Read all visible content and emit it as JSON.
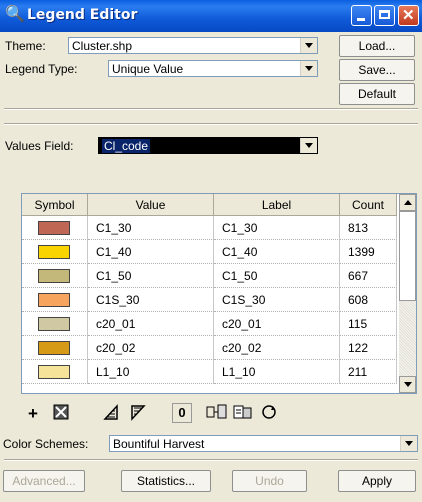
{
  "window": {
    "title": "Legend Editor"
  },
  "theme": {
    "label": "Theme:",
    "value": "Cluster.shp"
  },
  "legend_type": {
    "label": "Legend Type:",
    "value": "Unique Value"
  },
  "buttons": {
    "load": "Load...",
    "save": "Save...",
    "default": "Default",
    "advanced": "Advanced...",
    "statistics": "Statistics...",
    "undo": "Undo",
    "apply": "Apply"
  },
  "values_field": {
    "label": "Values Field:",
    "value": "Cl_code"
  },
  "table": {
    "headers": [
      "Symbol",
      "Value",
      "Label",
      "Count"
    ],
    "rows": [
      {
        "color": "#c06655",
        "value": "C1_30",
        "label": "C1_30",
        "count": "813"
      },
      {
        "color": "#f9d400",
        "value": "C1_40",
        "label": "C1_40",
        "count": "1399"
      },
      {
        "color": "#c3b879",
        "value": "C1_50",
        "label": "C1_50",
        "count": "667"
      },
      {
        "color": "#f6a45e",
        "value": "C1S_30",
        "label": "C1S_30",
        "count": "608"
      },
      {
        "color": "#cfc8a2",
        "value": "c20_01",
        "label": "c20_01",
        "count": "115"
      },
      {
        "color": "#d69a16",
        "value": "c20_02",
        "label": "c20_02",
        "count": "122"
      },
      {
        "color": "#f5e39a",
        "value": "L1_10",
        "label": "L1_10",
        "count": "211"
      }
    ]
  },
  "toolbar": {
    "null_value_label": "0"
  },
  "color_schemes": {
    "label": "Color Schemes:",
    "value": "Bountiful Harvest"
  }
}
